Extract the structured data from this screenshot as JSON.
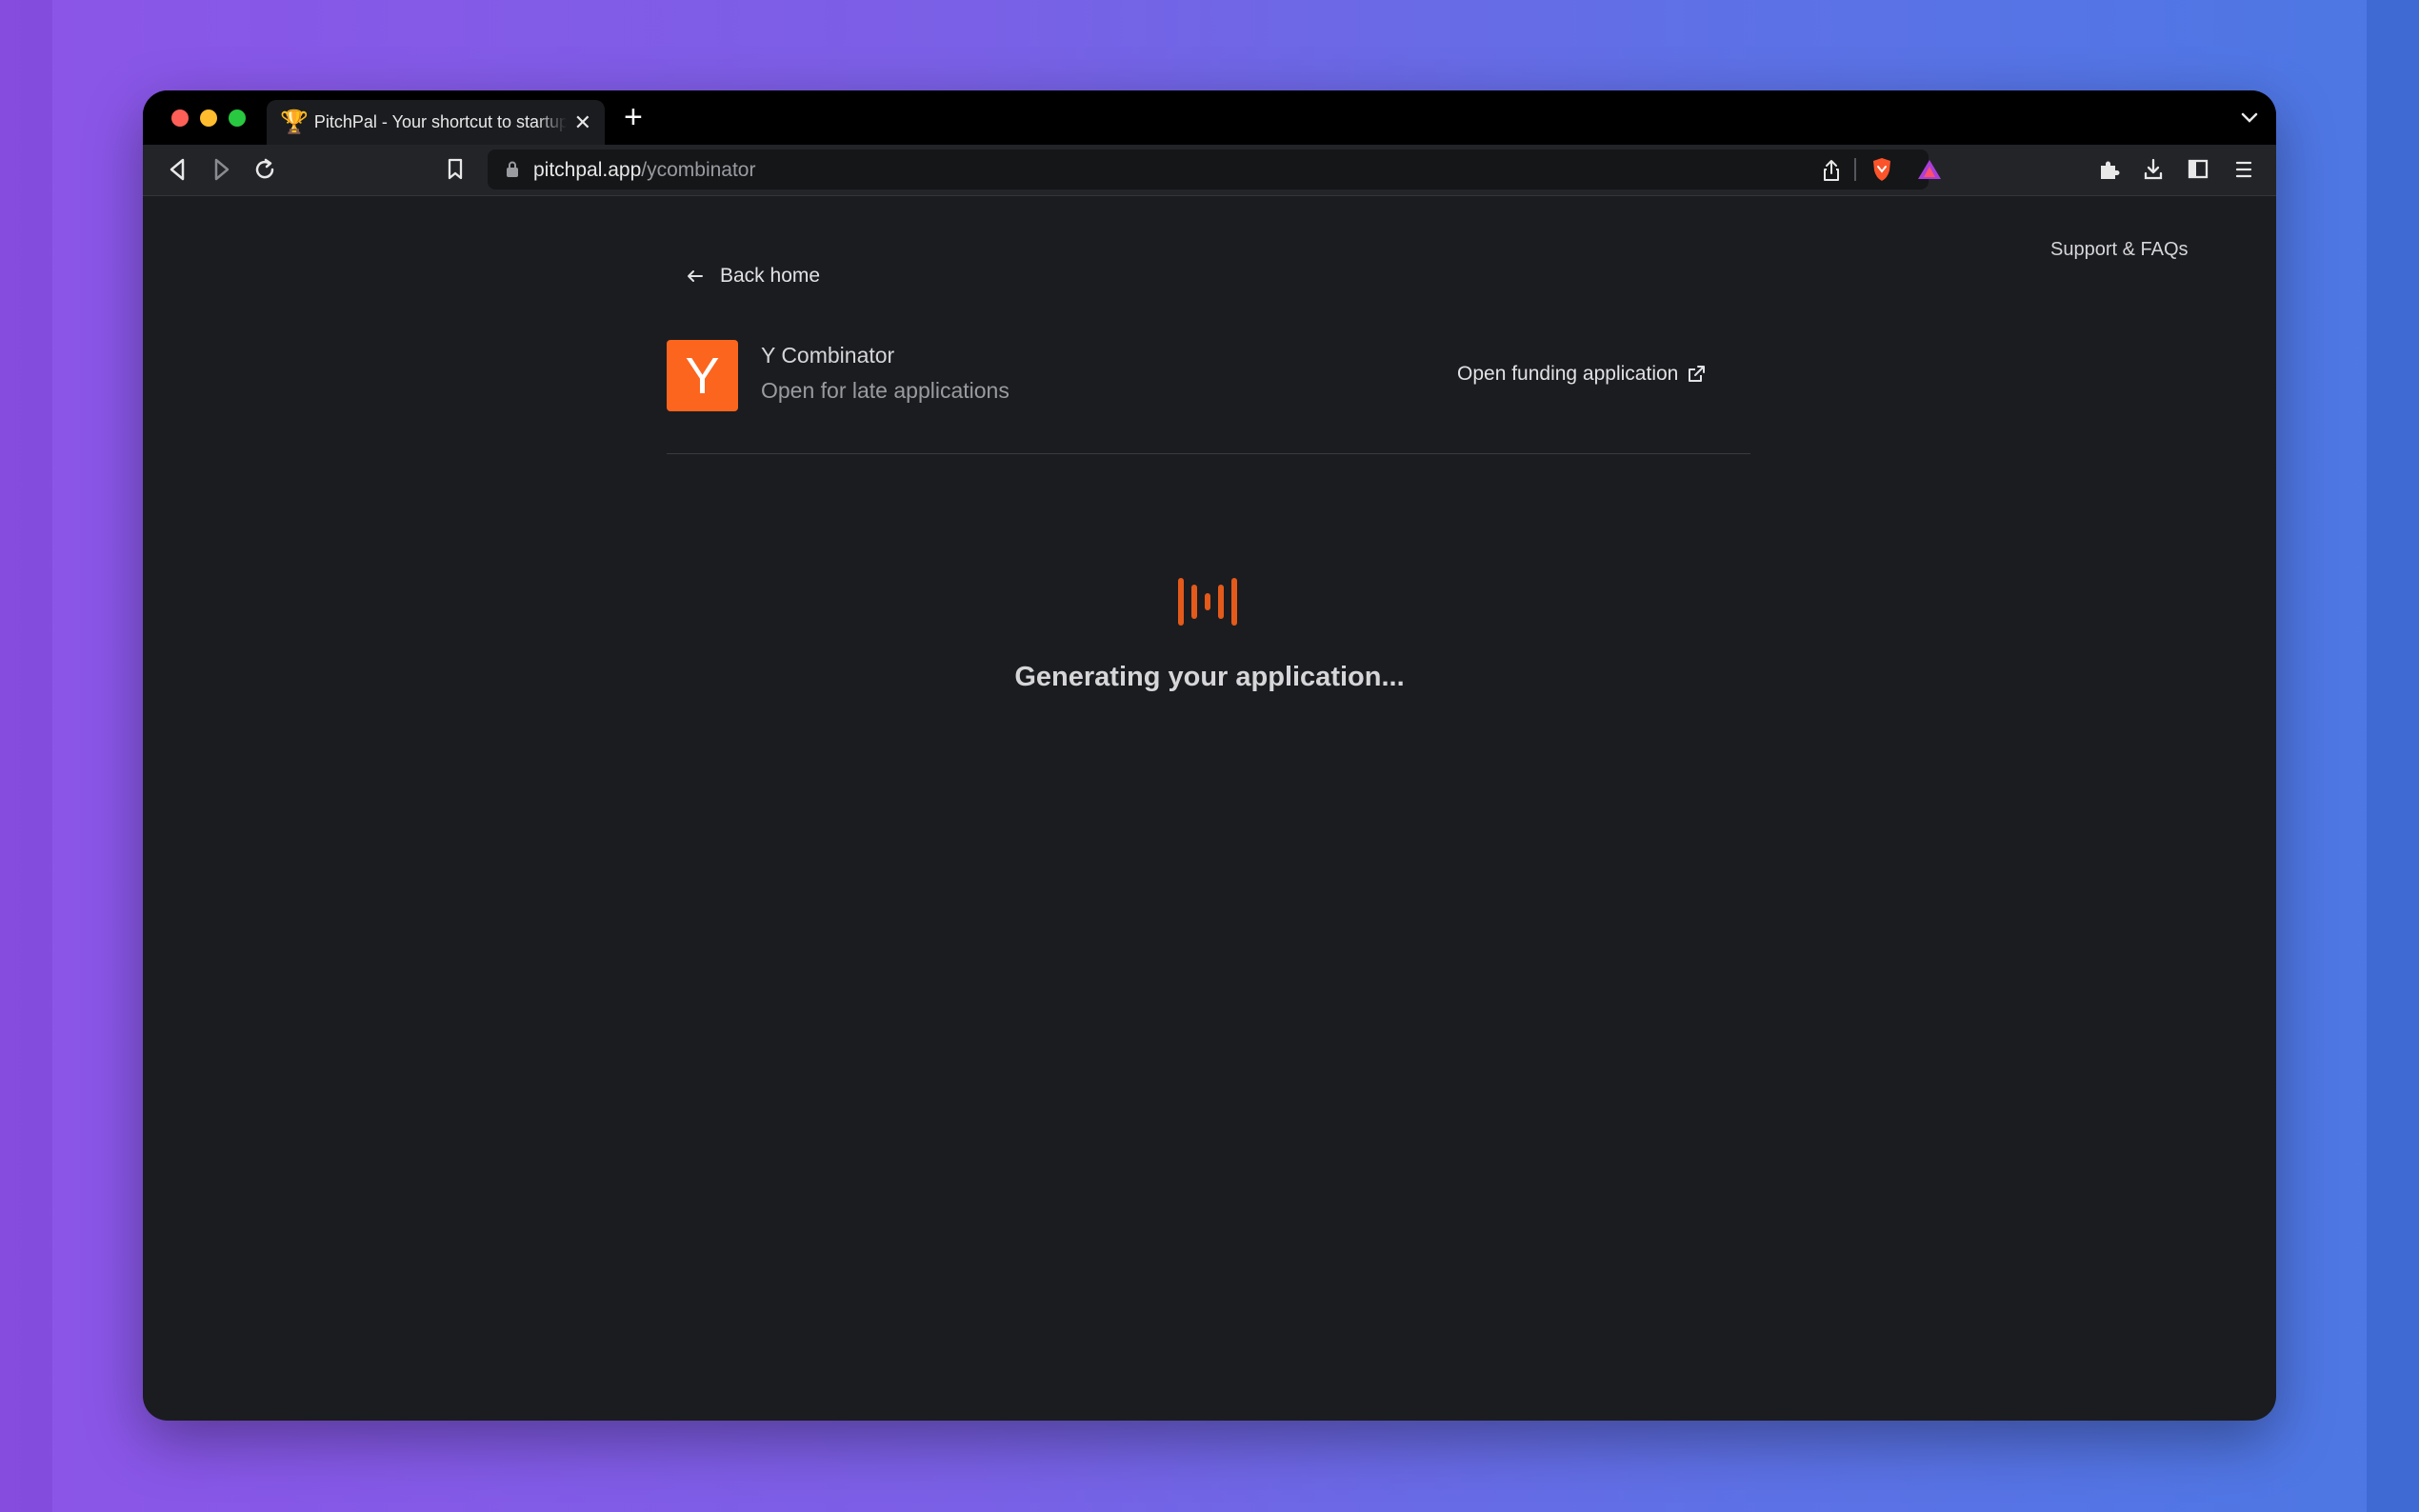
{
  "browser": {
    "tab": {
      "favicon": "🏆",
      "title": "PitchPal - Your shortcut to startup funding",
      "close": "✕"
    },
    "new_tab": "+",
    "url": {
      "domain": "pitchpal.app",
      "path": "/ycombinator"
    }
  },
  "header": {
    "support_link": "Support & FAQs"
  },
  "nav": {
    "back_label": "Back home"
  },
  "org": {
    "logo_letter": "Y",
    "name": "Y Combinator",
    "status": "Open for late applications",
    "funding_link": "Open funding application"
  },
  "status": {
    "message": "Generating your application..."
  },
  "colors": {
    "accent": "#fb651e",
    "loader": "#e35a1b",
    "background": "#1b1c20"
  }
}
